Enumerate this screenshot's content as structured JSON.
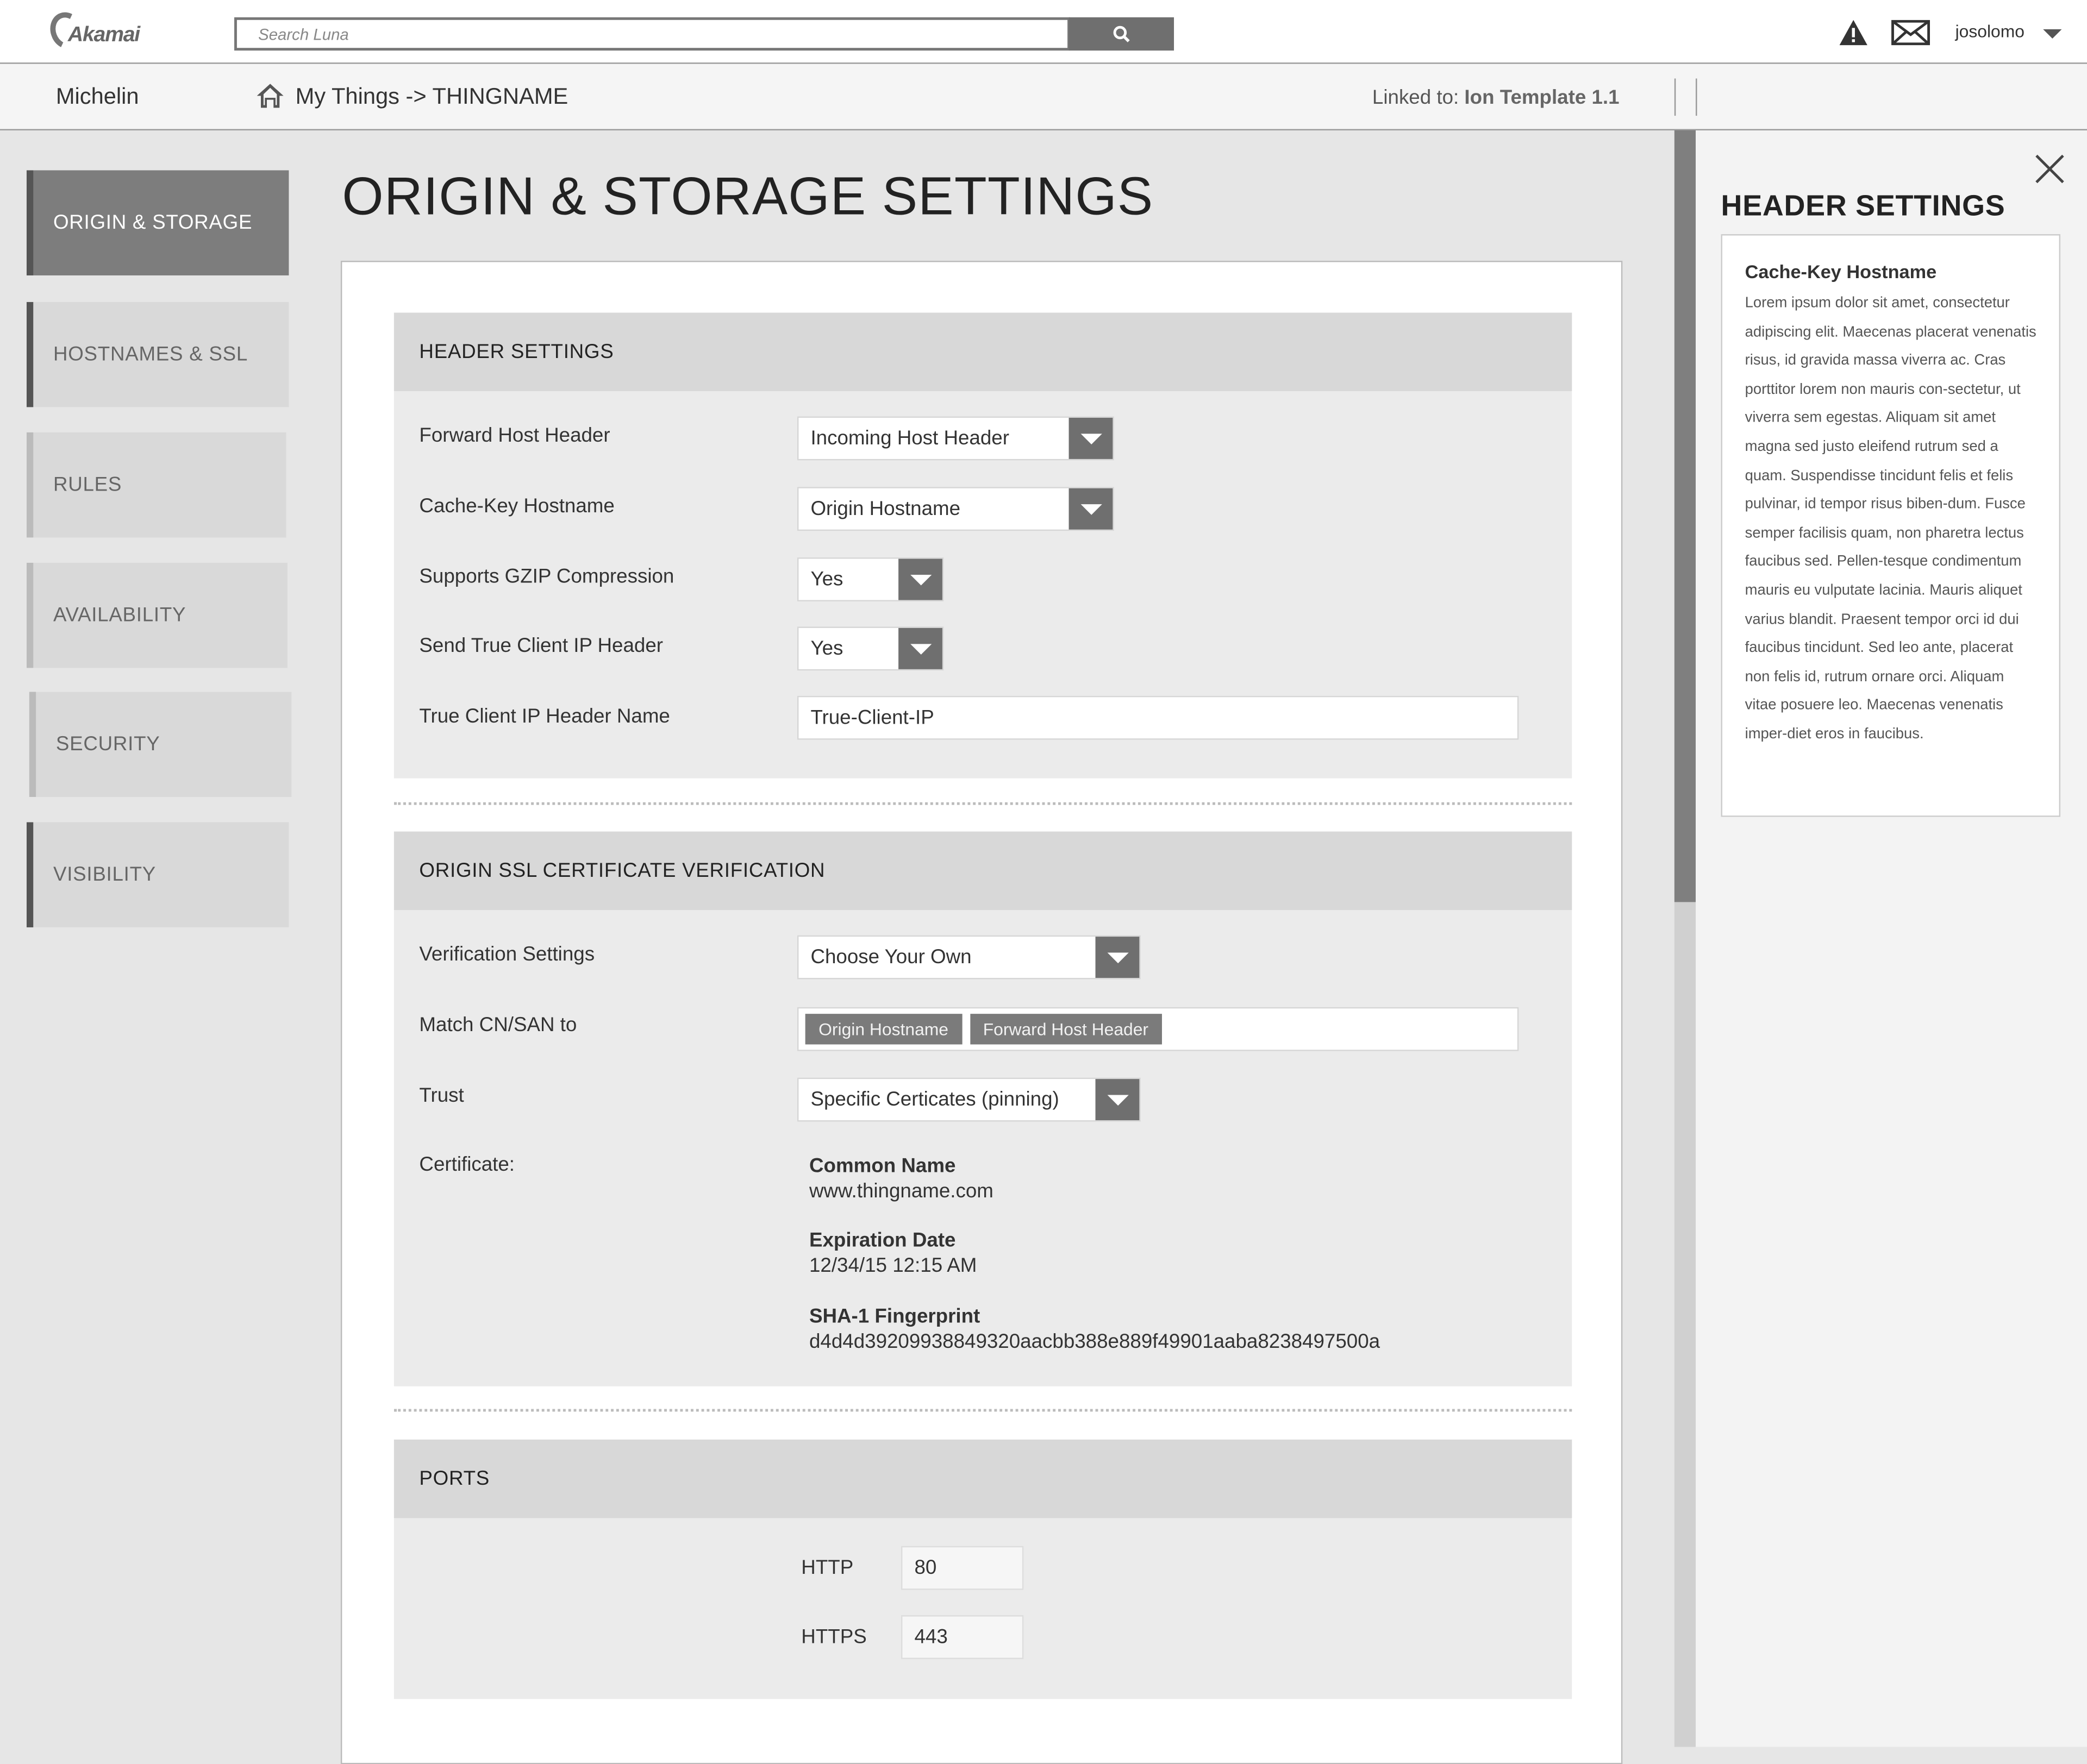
{
  "topbar": {
    "logo_text": "Akamai",
    "search_placeholder": "Search Luna",
    "username": "josolomo",
    "icons": [
      "warning-icon",
      "mail-icon",
      "search-icon",
      "caret-down-icon"
    ]
  },
  "navbar": {
    "account": "Michelin",
    "breadcrumb": "My Things -> THINGNAME",
    "linked_prefix": "Linked to:",
    "linked_template": "Ion Template 1.1"
  },
  "sidenav": {
    "items": [
      {
        "label": "ORIGIN & STORAGE",
        "active": true
      },
      {
        "label": "HOSTNAMES & SSL",
        "active": false
      },
      {
        "label": "RULES",
        "active": false
      },
      {
        "label": "AVAILABILITY",
        "active": false
      },
      {
        "label": "SECURITY",
        "active": false
      },
      {
        "label": "VISIBILITY",
        "active": false
      }
    ]
  },
  "main": {
    "title": "ORIGIN & STORAGE SETTINGS",
    "header_settings": {
      "title": "HEADER SETTINGS",
      "forward_host_header": {
        "label": "Forward Host Header",
        "value": "Incoming Host Header"
      },
      "cache_key_hostname": {
        "label": "Cache-Key Hostname",
        "value": "Origin Hostname"
      },
      "gzip": {
        "label": "Supports GZIP Compression",
        "value": "Yes"
      },
      "true_client_ip": {
        "label": "Send True Client IP Header",
        "value": "Yes"
      },
      "true_client_ip_name": {
        "label": "True Client IP Header Name",
        "value": "True-Client-IP"
      }
    },
    "ssl": {
      "title": "ORIGIN SSL CERTIFICATE VERIFICATION",
      "verification": {
        "label": "Verification Settings",
        "value": "Choose Your Own"
      },
      "match": {
        "label": "Match CN/SAN to",
        "tags": [
          "Origin Hostname",
          "Forward Host Header"
        ]
      },
      "trust": {
        "label": "Trust",
        "value": "Specific Certicates (pinning)"
      },
      "certificate": {
        "label": "Certificate:",
        "common_name_label": "Common Name",
        "common_name": "www.thingname.com",
        "expiration_label": "Expiration Date",
        "expiration": "12/34/15 12:15 AM",
        "sha1_label": "SHA-1 Fingerprint",
        "sha1": "d4d4d39209938849320aacbb388e889f49901aaba8238497500a"
      }
    },
    "ports": {
      "title": "PORTS",
      "http": {
        "label": "HTTP",
        "value": "80"
      },
      "https": {
        "label": "HTTPS",
        "value": "443"
      }
    }
  },
  "help_panel": {
    "title": "HEADER SETTINGS",
    "card_title": "Cache-Key Hostname",
    "card_body": "Lorem ipsum dolor sit amet, consectetur adipiscing elit. Maecenas placerat venenatis risus, id gravida massa viverra ac. Cras porttitor lorem non mauris con-sectetur, ut viverra sem egestas. Aliquam sit amet magna sed justo eleifend rutrum sed a quam. Suspendisse tincidunt felis et felis pulvinar, id tempor risus biben-dum. Fusce semper facilisis quam, non pharetra lectus faucibus sed. Pellen-tesque condimentum mauris eu vulputate lacinia. Mauris aliquet varius blandit. Praesent tempor orci id dui faucibus tincidunt. Sed leo ante, placerat non felis id, rutrum ornare orci. Aliquam vitae posuere leo. Maecenas venenatis imper-diet eros in faucibus."
  }
}
